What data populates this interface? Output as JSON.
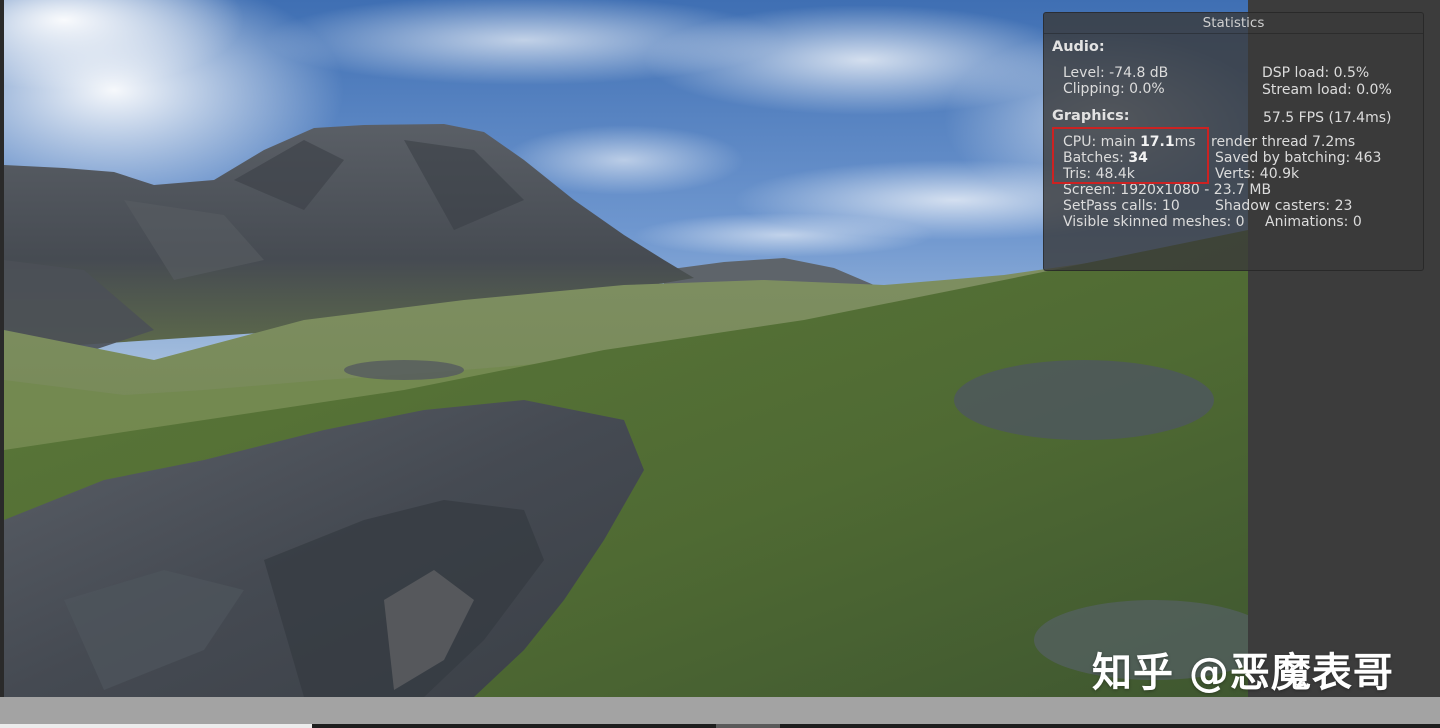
{
  "statistics": {
    "title": "Statistics",
    "audio": {
      "header": "Audio:",
      "level": "Level: -74.8 dB",
      "clipping": "Clipping: 0.0%",
      "dsp_load": "DSP load: 0.5%",
      "stream_load": "Stream load: 0.0%"
    },
    "graphics": {
      "header": "Graphics:",
      "fps": "57.5 FPS (17.4ms)",
      "cpu_main_label": "CPU: main ",
      "cpu_main_value": "17.1",
      "cpu_main_unit": "ms",
      "render_thread": "render thread 7.2ms",
      "batches_label": "Batches: ",
      "batches_value": "34",
      "saved_by_batching": "Saved by batching: 463",
      "tris": "Tris: 48.4k",
      "verts": "Verts: 40.9k",
      "screen": "Screen: 1920x1080 - 23.7 MB",
      "setpass_calls": "SetPass calls: 10",
      "shadow_casters": "Shadow casters: 23",
      "visible_skinned_meshes": "Visible skinned meshes: 0",
      "animations": "Animations: 0"
    },
    "highlight_color": "#cc2222"
  },
  "scene": {
    "sky_color": "#4f7fbf",
    "grass_color": "#5f7a3c",
    "rock_color": "#4a4f55"
  },
  "watermark": "知乎 @恶魔表哥"
}
